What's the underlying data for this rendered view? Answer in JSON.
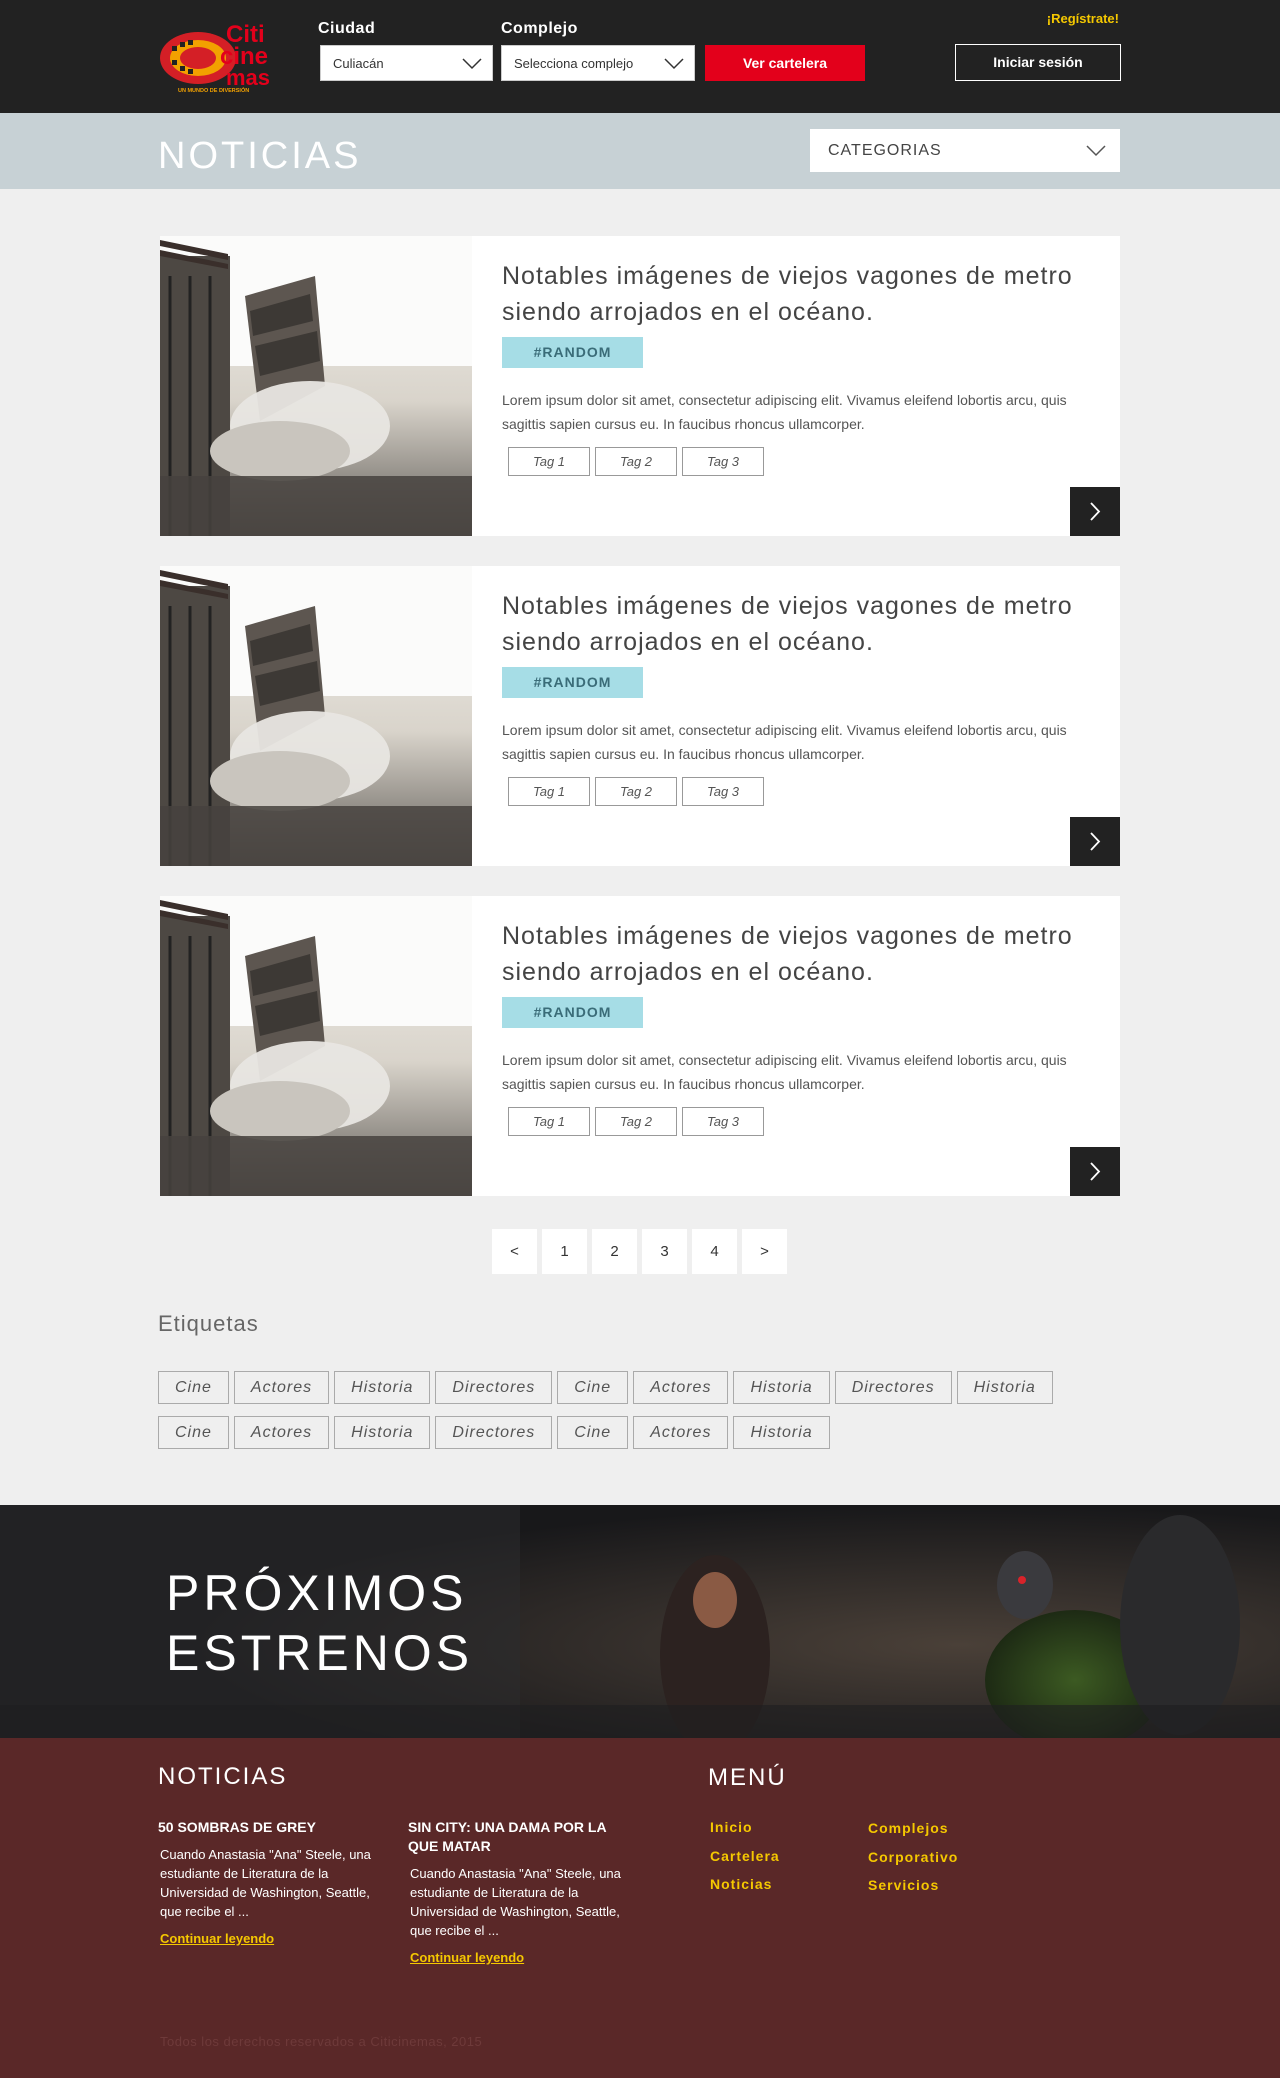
{
  "header": {
    "logo_text": [
      "Citi",
      "cine",
      "mas"
    ],
    "logo_tagline": "UN MUNDO DE DIVERSIÓN",
    "city_label": "Ciudad",
    "city_value": "Culiacán",
    "complex_label": "Complejo",
    "complex_value": "Selecciona complejo",
    "show_button": "Ver cartelera",
    "register": "¡Regístrate!",
    "login": "Iniciar sesión"
  },
  "news_bar": {
    "title": "NOTICIAS",
    "categories": "CATEGORIAS"
  },
  "articles": [
    {
      "title": "Notables imágenes de viejos vagones de metro siendo arrojados en el océano.",
      "category": "#RANDOM",
      "excerpt": "Lorem ipsum dolor sit amet, consectetur adipiscing elit. Vivamus eleifend lobortis arcu, quis sagittis sapien cursus eu. In faucibus rhoncus ullamcorper.",
      "tags": [
        "Tag 1",
        "Tag 2",
        "Tag 3"
      ]
    },
    {
      "title": "Notables imágenes de viejos vagones de metro siendo arrojados en el océano.",
      "category": "#RANDOM",
      "excerpt": "Lorem ipsum dolor sit amet, consectetur adipiscing elit. Vivamus eleifend lobortis arcu, quis sagittis sapien cursus eu. In faucibus rhoncus ullamcorper.",
      "tags": [
        "Tag 1",
        "Tag 2",
        "Tag 3"
      ]
    },
    {
      "title": "Notables imágenes de viejos vagones de metro siendo arrojados en el océano.",
      "category": "#RANDOM",
      "excerpt": "Lorem ipsum dolor sit amet, consectetur adipiscing elit. Vivamus eleifend lobortis arcu, quis sagittis sapien cursus eu. In faucibus rhoncus ullamcorper.",
      "tags": [
        "Tag 1",
        "Tag 2",
        "Tag 3"
      ]
    }
  ],
  "pagination": [
    "<",
    "1",
    "2",
    "3",
    "4",
    ">"
  ],
  "tags_section": {
    "title": "Etiquetas",
    "tags": [
      "Cine",
      "Actores",
      "Historia",
      "Directores",
      "Cine",
      "Actores",
      "Historia",
      "Directores",
      "Historia",
      "Cine",
      "Actores",
      "Historia",
      "Directores",
      "Cine",
      "Actores",
      "Historia"
    ]
  },
  "upcoming": {
    "line1": "PRÓXIMOS",
    "line2": "ESTRENOS"
  },
  "footer": {
    "news_title": "NOTICIAS",
    "news": [
      {
        "title": "50 SOMBRAS DE GREY",
        "excerpt": "Cuando Anastasia \"Ana\" Steele, una estudiante de Literatura de la Universidad de Washington, Seattle, que recibe el ...",
        "link": "Continuar leyendo"
      },
      {
        "title": "SIN CITY: UNA DAMA POR LA QUE MATAR",
        "excerpt": "Cuando Anastasia \"Ana\" Steele, una estudiante de Literatura de la Universidad de Washington, Seattle, que recibe el ...",
        "link": "Continuar leyendo"
      }
    ],
    "menu_title": "MENÚ",
    "menu_col1": [
      "Inicio",
      "Cartelera",
      "Noticias"
    ],
    "menu_col2": [
      "Complejos",
      "Corporativo",
      "Servicios"
    ],
    "copyright": "Todos los derechos reservados a Citicinemas, 2015"
  },
  "colors": {
    "header_bg": "#222222",
    "accent_red": "#e3001b",
    "accent_yellow": "#f5c800",
    "news_bar_bg": "#c7d1d5",
    "category_badge": "#a6dde6",
    "footer_bg": "#5a2828"
  },
  "icons": [
    "chevron-down-icon",
    "chevron-right-icon"
  ]
}
